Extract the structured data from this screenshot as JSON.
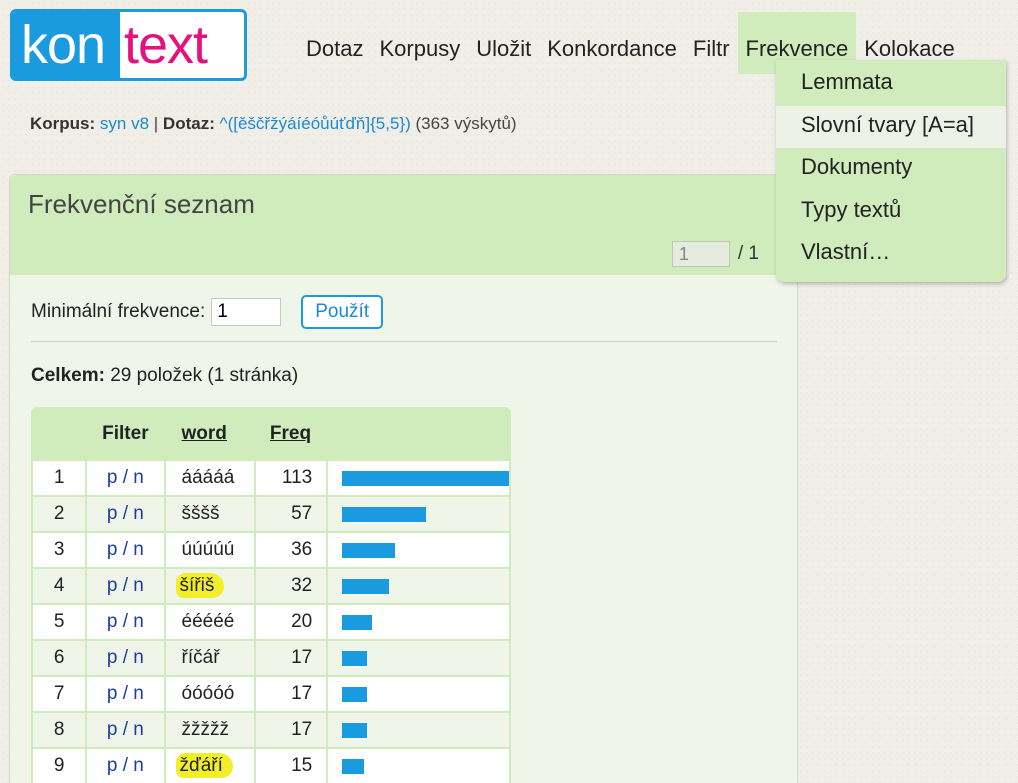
{
  "logo": {
    "part1": "kon",
    "part2": "text"
  },
  "menu": [
    {
      "label": "Dotaz",
      "active": false
    },
    {
      "label": "Korpusy",
      "active": false
    },
    {
      "label": "Uložit",
      "active": false
    },
    {
      "label": "Konkordance",
      "active": false
    },
    {
      "label": "Filtr",
      "active": false
    },
    {
      "label": "Frekvence",
      "active": true
    },
    {
      "label": "Kolokace",
      "active": false
    }
  ],
  "dropdown": [
    {
      "label": "Lemmata"
    },
    {
      "label": "Slovní tvary [A=a]"
    },
    {
      "label": "Dokumenty"
    },
    {
      "label": "Typy textů"
    },
    {
      "label": "Vlastní…"
    }
  ],
  "breadcrumb": {
    "corpus_label": "Korpus:",
    "corpus": "syn v8",
    "sep": " | ",
    "query_label": "Dotaz:",
    "query": "^([ěščřžýáíéóůúťďň]{5,5})",
    "hits": " (363 výskytů)"
  },
  "panel": {
    "title": "Frekvenční seznam",
    "page_value": "1",
    "page_total": "/ 1",
    "minfreq_label": "Minimální frekvence:",
    "minfreq_value": "1",
    "apply_label": "Použít",
    "total_label": "Celkem:",
    "total_text": " 29 položek (1 stránka)"
  },
  "table": {
    "headers": {
      "num": "",
      "filter": "Filter",
      "word": "word",
      "freq": "Freq"
    },
    "filter_p": "p",
    "filter_sep": " / ",
    "filter_n": "n",
    "rows": [
      {
        "num": "1",
        "word": "ááááá",
        "freq": "113",
        "highlight": false
      },
      {
        "num": "2",
        "word": "šššš",
        "freq": "57",
        "highlight": false
      },
      {
        "num": "3",
        "word": "úúúúú",
        "freq": "36",
        "highlight": false
      },
      {
        "num": "4",
        "word": "šířiš",
        "freq": "32",
        "highlight": true
      },
      {
        "num": "5",
        "word": "ééééé",
        "freq": "20",
        "highlight": false
      },
      {
        "num": "6",
        "word": "říčář",
        "freq": "17",
        "highlight": false
      },
      {
        "num": "7",
        "word": "óóóóó",
        "freq": "17",
        "highlight": false
      },
      {
        "num": "8",
        "word": "žžžžž",
        "freq": "17",
        "highlight": false
      },
      {
        "num": "9",
        "word": "žďáří",
        "freq": "15",
        "highlight": true
      }
    ],
    "max_freq": 113
  },
  "colors": {
    "accent": "#1a9be0",
    "brand_pink": "#e5127d",
    "panel_green": "#d0ecbc",
    "highlight": "#f2ef2a"
  }
}
